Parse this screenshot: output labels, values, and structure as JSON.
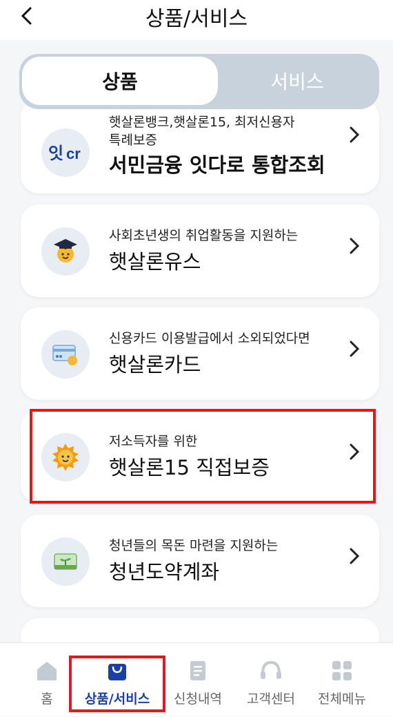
{
  "header": {
    "back_icon": "chevron-left-icon",
    "title": "상품/서비스"
  },
  "toggle": {
    "active": "상품",
    "inactive": "서비스"
  },
  "cards": [
    {
      "subtitle_line1": "햇살론뱅크,햇살론15, 최저신용자",
      "subtitle_line2": "특례보증",
      "title": "서민금융 잇다로 통합조회",
      "icon": "itda-logo-icon"
    },
    {
      "subtitle": "사회초년생의 취업활동을 지원하는",
      "title": "햇살론유스",
      "icon": "graduate-sun-icon"
    },
    {
      "subtitle": "신용카드 이용발급에서 소외되었다면",
      "title": "햇살론카드",
      "icon": "card-sun-icon"
    },
    {
      "subtitle": "저소득자를 위한",
      "title": "햇살론15 직접보증",
      "icon": "sun-icon"
    },
    {
      "subtitle": "청년들의 목돈 마련을 지원하는",
      "title": "청년도약계좌",
      "icon": "sprout-icon"
    }
  ],
  "tabbar": {
    "items": [
      {
        "label": "홈",
        "icon": "home-icon"
      },
      {
        "label": "상품/서비스",
        "icon": "shopping-bag-icon"
      },
      {
        "label": "신청내역",
        "icon": "document-icon"
      },
      {
        "label": "고객센터",
        "icon": "headset-icon"
      },
      {
        "label": "전체메뉴",
        "icon": "grid-menu-icon"
      }
    ],
    "active_index": 1
  },
  "colors": {
    "accent": "#1a3fa8",
    "highlight": "#e3181f",
    "toggle_bg": "#c8d2dc"
  }
}
